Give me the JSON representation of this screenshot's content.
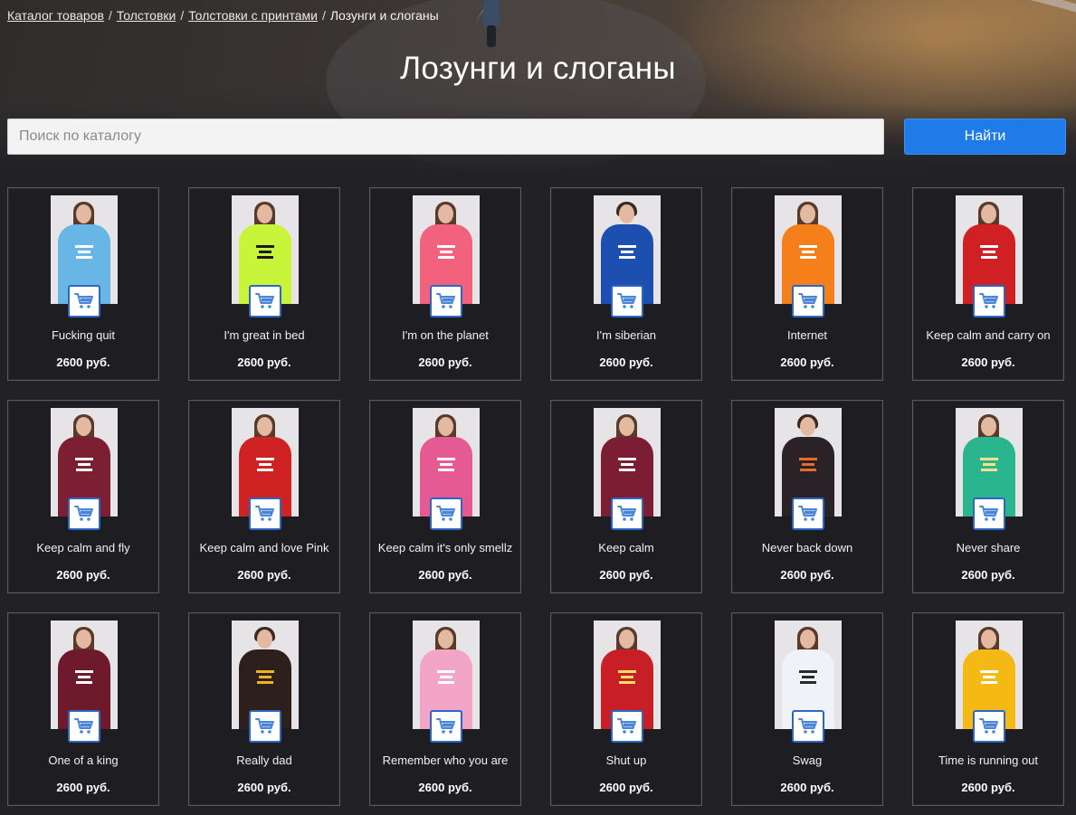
{
  "breadcrumb": {
    "items": [
      {
        "label": "Каталог товаров"
      },
      {
        "label": "Толстовки"
      },
      {
        "label": "Толстовки с принтами"
      }
    ],
    "separator": "/",
    "current": "Лозунги и слоганы"
  },
  "page": {
    "title": "Лозунги и слоганы"
  },
  "search": {
    "placeholder": "Поиск по каталогу",
    "value": "",
    "button_label": "Найти"
  },
  "icons": {
    "cart": "shopping-cart-icon"
  },
  "colors": {
    "accent": "#1f7be8",
    "background": "#222226",
    "card_border": "#5a5a5e"
  },
  "products": [
    {
      "name": "Fucking quit",
      "price": "2600 руб.",
      "hoodie_color": "#67b6e6",
      "print_color": "#ffffff",
      "hair": "long"
    },
    {
      "name": "I'm great in bed",
      "price": "2600 руб.",
      "hoodie_color": "#c8f53a",
      "print_color": "#1b1b1b",
      "hair": "long"
    },
    {
      "name": "I'm on the planet",
      "price": "2600 руб.",
      "hoodie_color": "#f2627c",
      "print_color": "#ffffff",
      "hair": "long"
    },
    {
      "name": "I'm siberian",
      "price": "2600 руб.",
      "hoodie_color": "#1c4fb0",
      "print_color": "#ffffff",
      "hair": "short"
    },
    {
      "name": "Internet",
      "price": "2600 руб.",
      "hoodie_color": "#f57f1b",
      "print_color": "#ffffff",
      "hair": "long"
    },
    {
      "name": "Keep calm and carry on",
      "price": "2600 руб.",
      "hoodie_color": "#cf2023",
      "print_color": "#ffffff",
      "hair": "long"
    },
    {
      "name": "Keep calm and fly",
      "price": "2600 руб.",
      "hoodie_color": "#7d1f32",
      "print_color": "#ffffff",
      "hair": "long"
    },
    {
      "name": "Keep calm and love Pink",
      "price": "2600 руб.",
      "hoodie_color": "#cf2323",
      "print_color": "#ffffff",
      "hair": "long"
    },
    {
      "name": "Keep calm it's only smellz",
      "price": "2600 руб.",
      "hoodie_color": "#e55a93",
      "print_color": "#ffffff",
      "hair": "long"
    },
    {
      "name": "Keep calm",
      "price": "2600 руб.",
      "hoodie_color": "#7b1e33",
      "print_color": "#ffffff",
      "hair": "long"
    },
    {
      "name": "Never back down",
      "price": "2600 руб.",
      "hoodie_color": "#2a2226",
      "print_color": "#e86b2e",
      "hair": "short"
    },
    {
      "name": "Never share",
      "price": "2600 руб.",
      "hoodie_color": "#2bb58f",
      "print_color": "#ffe08a",
      "hair": "long"
    },
    {
      "name": "One of a king",
      "price": "2600 руб.",
      "hoodie_color": "#6e1a2c",
      "print_color": "#ffffff",
      "hair": "long"
    },
    {
      "name": "Really dad",
      "price": "2600 руб.",
      "hoodie_color": "#2c1f1c",
      "print_color": "#f2b322",
      "hair": "short"
    },
    {
      "name": "Remember who you are",
      "price": "2600 руб.",
      "hoodie_color": "#f3a5c7",
      "print_color": "#ffffff",
      "hair": "long"
    },
    {
      "name": "Shut up",
      "price": "2600 руб.",
      "hoodie_color": "#c81f26",
      "print_color": "#ffe066",
      "hair": "long"
    },
    {
      "name": "Swag",
      "price": "2600 руб.",
      "hoodie_color": "#eff3f8",
      "print_color": "#2a2a2a",
      "hair": "long"
    },
    {
      "name": "Time is running out",
      "price": "2600 руб.",
      "hoodie_color": "#f4b915",
      "print_color": "#ffffff",
      "hair": "long"
    }
  ]
}
